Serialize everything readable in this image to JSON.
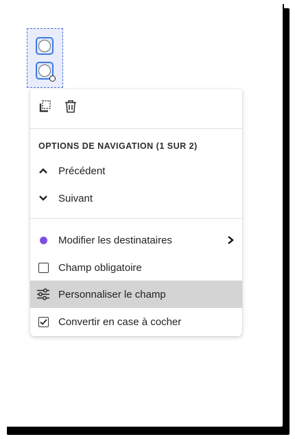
{
  "colors": {
    "selection_border": "#4a72d6",
    "radio_border": "#3e7be2",
    "recipient_dot": "#7e4ee0",
    "highlight_bg": "#d4d4d4"
  },
  "toolbar": {
    "duplicate_icon": "duplicate-field-icon",
    "delete_icon": "trash-icon"
  },
  "menu": {
    "section_heading": "OPTIONS DE NAVIGATION (1 SUR 2)",
    "items": [
      {
        "label": "Précédent",
        "icon": "chevron-up-icon"
      },
      {
        "label": "Suivant",
        "icon": "chevron-down-icon"
      },
      {
        "label": "Modifier les destinataires",
        "icon": "purple-dot-icon",
        "submenu": true
      },
      {
        "label": "Champ obligatoire",
        "icon": "checkbox-empty-icon"
      },
      {
        "label": "Personnaliser le champ",
        "icon": "sliders-icon",
        "highlighted": true
      },
      {
        "label": "Convertir en case à cocher",
        "icon": "checkbox-checked-icon"
      }
    ]
  }
}
